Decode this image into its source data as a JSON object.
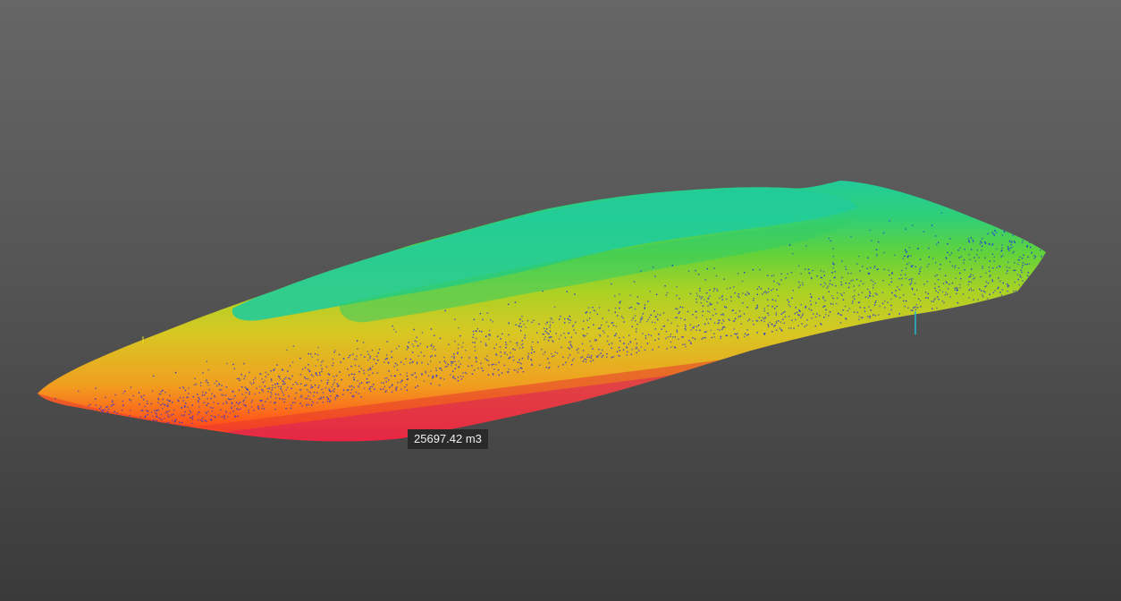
{
  "viewport": {
    "background_top": "#666666",
    "background_bottom": "#3a3a3a"
  },
  "point_cloud": {
    "color_ramp": [
      "#d81b60",
      "#ff2a2a",
      "#ff8c1a",
      "#e8c020",
      "#b5d21f",
      "#6ed23a",
      "#2fcf7a",
      "#22cc99"
    ],
    "noise_color": "#1f2fe0"
  },
  "measurement": {
    "volume_label": "25697.42 m3"
  }
}
